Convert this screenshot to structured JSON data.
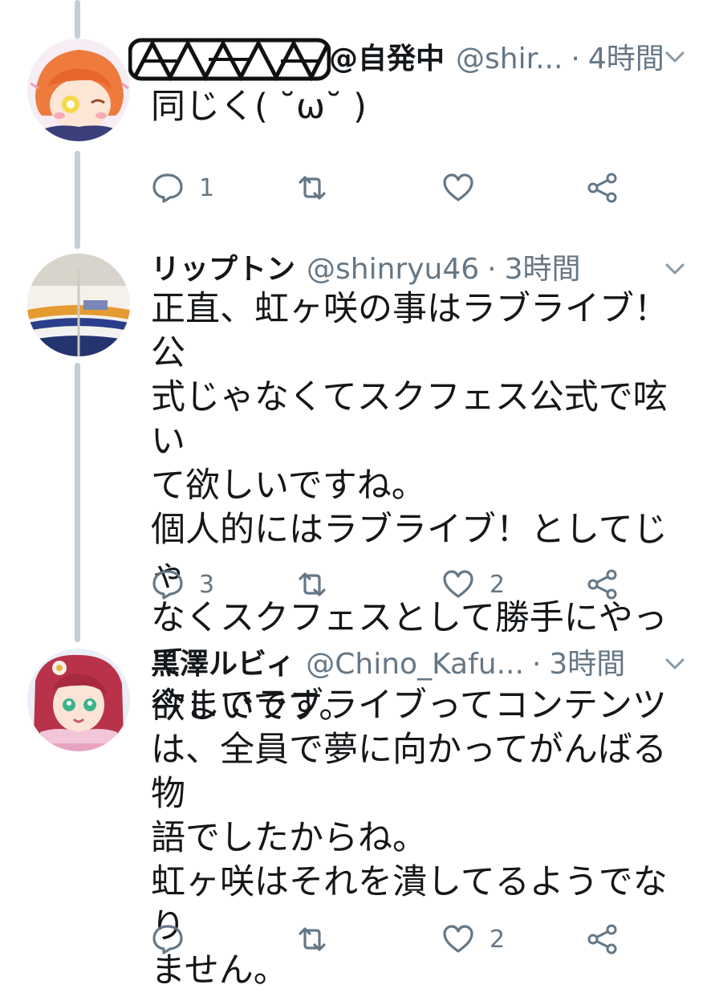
{
  "tweets": [
    {
      "name": "@自発中",
      "handle": "@shir...",
      "time": "4時間",
      "text": "同じく( ˘ω˘ )",
      "replies": "1",
      "retweets": "",
      "likes": ""
    },
    {
      "name": "リップトン",
      "handle": "@shinryu46",
      "time": "3時間",
      "text": "正直、虹ヶ咲の事はラブライブ！公\n式じゃなくてスクフェス公式で呟い\nて欲しいですね。\n個人的にはラブライブ！としてじゃ\nなくスクフェスとして勝手にやって\n欲しいです。",
      "replies": "3",
      "retweets": "",
      "likes": "2"
    },
    {
      "name": "黒澤ルビィ",
      "handle": "@Chino_Kafu...",
      "time": "3時間",
      "text": "今までラブライブってコンテンツ\nは、全員で夢に向かってがんばる物\n語でしたからね。\n虹ヶ咲はそれを潰してるようでなり\nません。",
      "replies": "",
      "retweets": "",
      "likes": "2"
    }
  ],
  "separator": "·",
  "icons": {
    "reply": "reply-icon",
    "retweet": "retweet-icon",
    "like": "heart-icon",
    "share": "share-icon",
    "menu": "chevron-down-icon"
  },
  "colors": {
    "text": "#14171a",
    "secondary": "#657786",
    "thread_line": "#c4cfd6"
  }
}
